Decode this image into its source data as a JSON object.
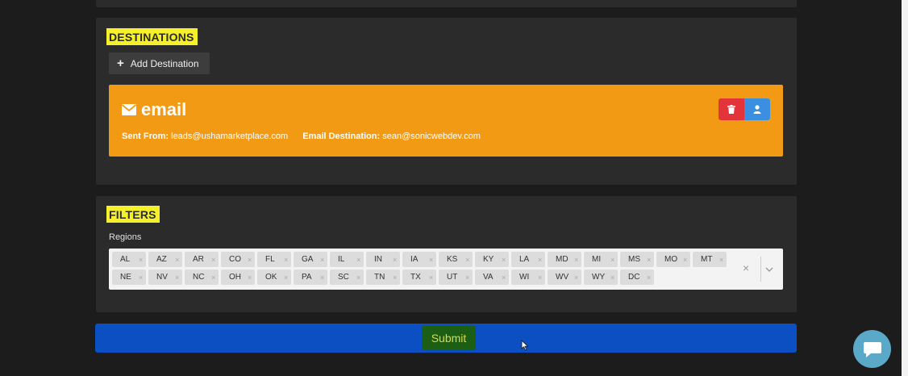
{
  "destinations": {
    "title": "DESTINATIONS",
    "add_label": "Add Destination",
    "card": {
      "type": "email",
      "sent_from_label": "Sent From:",
      "sent_from": "leads@ushamarketplace.com",
      "destination_label": "Email Destination:",
      "destination": "sean@sonicwebdev.com"
    }
  },
  "filters": {
    "title": "FILTERS",
    "regions_label": "Regions",
    "regions": [
      "AL",
      "AZ",
      "AR",
      "CO",
      "FL",
      "GA",
      "IL",
      "IN",
      "IA",
      "KS",
      "KY",
      "LA",
      "MD",
      "MI",
      "MS",
      "MO",
      "MT",
      "NE",
      "NV",
      "NC",
      "OH",
      "OK",
      "PA",
      "SC",
      "TN",
      "TX",
      "UT",
      "VA",
      "WI",
      "WV",
      "WY",
      "DC"
    ],
    "remove_glyph": "×",
    "clear_glyph": "×"
  },
  "submit": {
    "label": "Submit"
  },
  "colors": {
    "card": "#f39a14",
    "submit": "#0b4fc3",
    "delete": "#e3343a",
    "assign": "#3a8fe0",
    "highlight": "#f5f02a"
  },
  "icons": [
    "plus-icon",
    "envelope-icon",
    "trash-icon",
    "user-icon",
    "chevron-down-icon",
    "chat-icon",
    "mouse-pointer-icon"
  ]
}
